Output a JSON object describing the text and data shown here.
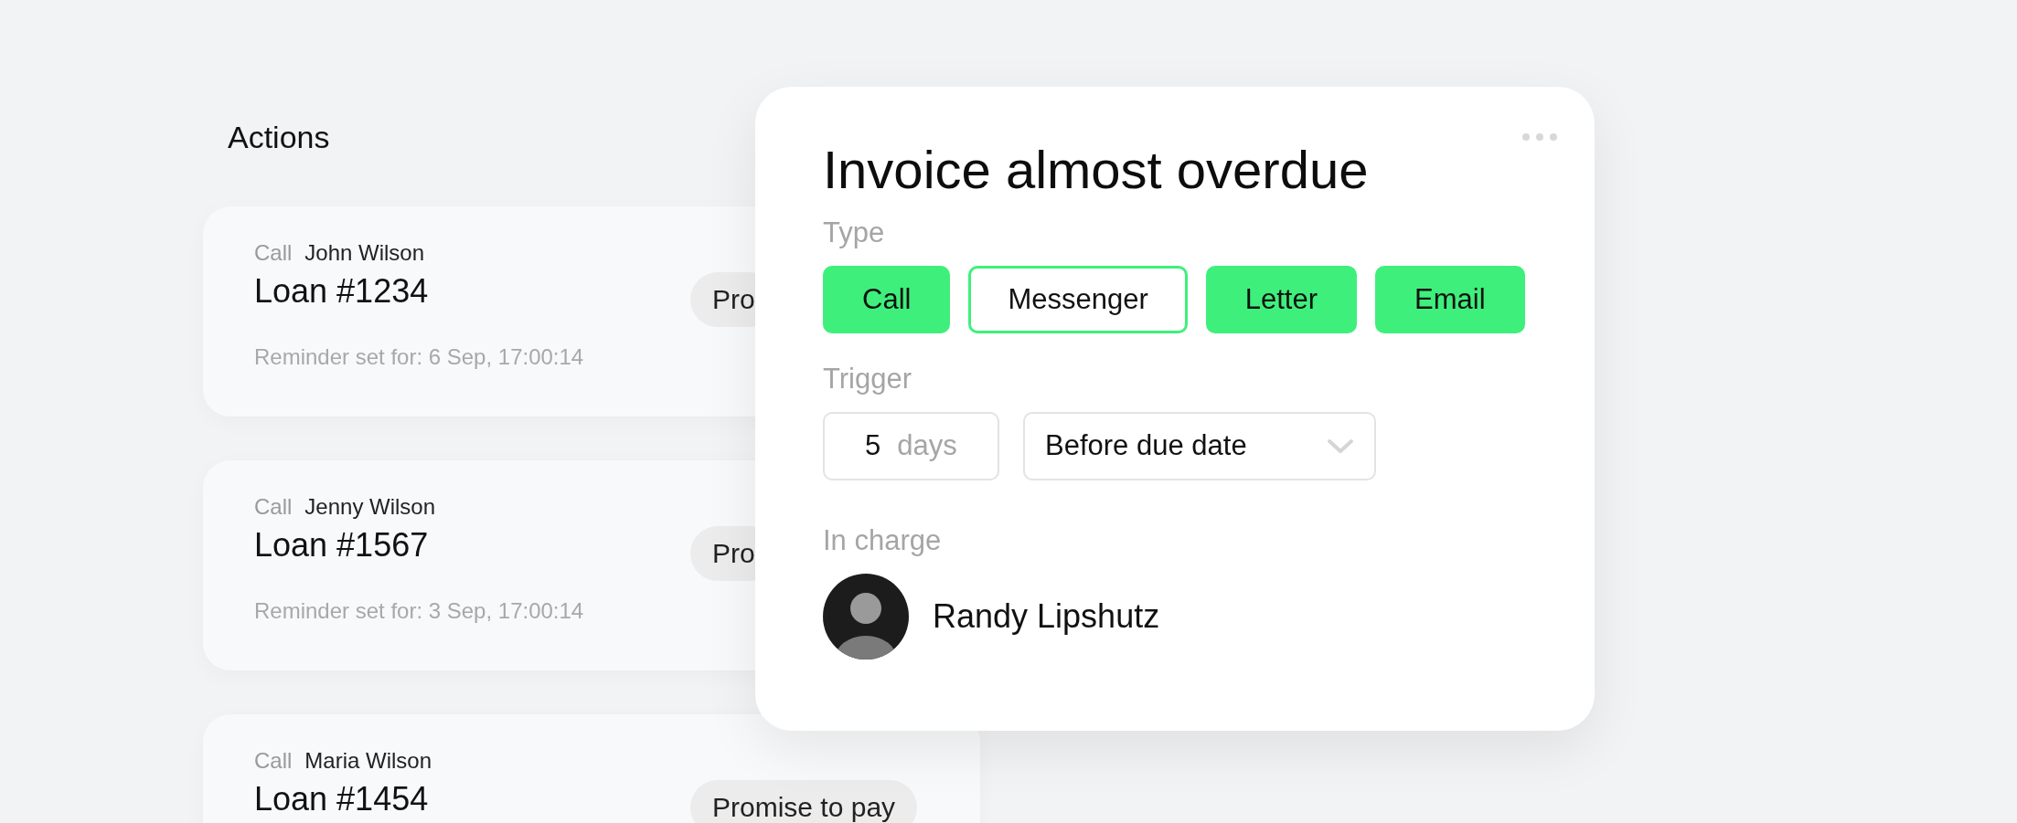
{
  "section_title": "Actions",
  "actions": [
    {
      "type": "Call",
      "name": "John Wilson",
      "loan": "Loan #1234",
      "status": "Pro",
      "reminder": "Reminder set for: 6 Sep, 17:00:14"
    },
    {
      "type": "Call",
      "name": "Jenny Wilson",
      "loan": "Loan #1567",
      "status": "Pro",
      "reminder": "Reminder set for: 3 Sep, 17:00:14"
    },
    {
      "type": "Call",
      "name": "Maria Wilson",
      "loan": "Loan #1454",
      "status": "Promise to pay"
    }
  ],
  "dialog": {
    "title": "Invoice almost overdue",
    "type_label": "Type",
    "types": [
      {
        "label": "Call",
        "selected": true
      },
      {
        "label": "Messenger",
        "selected": false
      },
      {
        "label": "Letter",
        "selected": true
      },
      {
        "label": "Email",
        "selected": true
      }
    ],
    "trigger_label": "Trigger",
    "days_value": "5",
    "days_unit": "days",
    "timing": "Before due date",
    "in_charge_label": "In charge",
    "assignee": "Randy Lipshutz"
  }
}
